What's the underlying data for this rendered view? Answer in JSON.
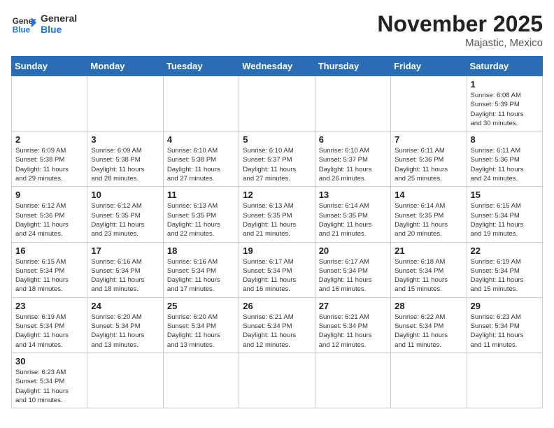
{
  "header": {
    "logo_general": "General",
    "logo_blue": "Blue",
    "month_title": "November 2025",
    "location": "Majastic, Mexico"
  },
  "weekdays": [
    "Sunday",
    "Monday",
    "Tuesday",
    "Wednesday",
    "Thursday",
    "Friday",
    "Saturday"
  ],
  "weeks": [
    [
      {
        "day": "",
        "info": ""
      },
      {
        "day": "",
        "info": ""
      },
      {
        "day": "",
        "info": ""
      },
      {
        "day": "",
        "info": ""
      },
      {
        "day": "",
        "info": ""
      },
      {
        "day": "",
        "info": ""
      },
      {
        "day": "1",
        "info": "Sunrise: 6:08 AM\nSunset: 5:39 PM\nDaylight: 11 hours\nand 30 minutes."
      }
    ],
    [
      {
        "day": "2",
        "info": "Sunrise: 6:09 AM\nSunset: 5:38 PM\nDaylight: 11 hours\nand 29 minutes."
      },
      {
        "day": "3",
        "info": "Sunrise: 6:09 AM\nSunset: 5:38 PM\nDaylight: 11 hours\nand 28 minutes."
      },
      {
        "day": "4",
        "info": "Sunrise: 6:10 AM\nSunset: 5:38 PM\nDaylight: 11 hours\nand 27 minutes."
      },
      {
        "day": "5",
        "info": "Sunrise: 6:10 AM\nSunset: 5:37 PM\nDaylight: 11 hours\nand 27 minutes."
      },
      {
        "day": "6",
        "info": "Sunrise: 6:10 AM\nSunset: 5:37 PM\nDaylight: 11 hours\nand 26 minutes."
      },
      {
        "day": "7",
        "info": "Sunrise: 6:11 AM\nSunset: 5:36 PM\nDaylight: 11 hours\nand 25 minutes."
      },
      {
        "day": "8",
        "info": "Sunrise: 6:11 AM\nSunset: 5:36 PM\nDaylight: 11 hours\nand 24 minutes."
      }
    ],
    [
      {
        "day": "9",
        "info": "Sunrise: 6:12 AM\nSunset: 5:36 PM\nDaylight: 11 hours\nand 24 minutes."
      },
      {
        "day": "10",
        "info": "Sunrise: 6:12 AM\nSunset: 5:35 PM\nDaylight: 11 hours\nand 23 minutes."
      },
      {
        "day": "11",
        "info": "Sunrise: 6:13 AM\nSunset: 5:35 PM\nDaylight: 11 hours\nand 22 minutes."
      },
      {
        "day": "12",
        "info": "Sunrise: 6:13 AM\nSunset: 5:35 PM\nDaylight: 11 hours\nand 21 minutes."
      },
      {
        "day": "13",
        "info": "Sunrise: 6:14 AM\nSunset: 5:35 PM\nDaylight: 11 hours\nand 21 minutes."
      },
      {
        "day": "14",
        "info": "Sunrise: 6:14 AM\nSunset: 5:35 PM\nDaylight: 11 hours\nand 20 minutes."
      },
      {
        "day": "15",
        "info": "Sunrise: 6:15 AM\nSunset: 5:34 PM\nDaylight: 11 hours\nand 19 minutes."
      }
    ],
    [
      {
        "day": "16",
        "info": "Sunrise: 6:15 AM\nSunset: 5:34 PM\nDaylight: 11 hours\nand 18 minutes."
      },
      {
        "day": "17",
        "info": "Sunrise: 6:16 AM\nSunset: 5:34 PM\nDaylight: 11 hours\nand 18 minutes."
      },
      {
        "day": "18",
        "info": "Sunrise: 6:16 AM\nSunset: 5:34 PM\nDaylight: 11 hours\nand 17 minutes."
      },
      {
        "day": "19",
        "info": "Sunrise: 6:17 AM\nSunset: 5:34 PM\nDaylight: 11 hours\nand 16 minutes."
      },
      {
        "day": "20",
        "info": "Sunrise: 6:17 AM\nSunset: 5:34 PM\nDaylight: 11 hours\nand 16 minutes."
      },
      {
        "day": "21",
        "info": "Sunrise: 6:18 AM\nSunset: 5:34 PM\nDaylight: 11 hours\nand 15 minutes."
      },
      {
        "day": "22",
        "info": "Sunrise: 6:19 AM\nSunset: 5:34 PM\nDaylight: 11 hours\nand 15 minutes."
      }
    ],
    [
      {
        "day": "23",
        "info": "Sunrise: 6:19 AM\nSunset: 5:34 PM\nDaylight: 11 hours\nand 14 minutes."
      },
      {
        "day": "24",
        "info": "Sunrise: 6:20 AM\nSunset: 5:34 PM\nDaylight: 11 hours\nand 13 minutes."
      },
      {
        "day": "25",
        "info": "Sunrise: 6:20 AM\nSunset: 5:34 PM\nDaylight: 11 hours\nand 13 minutes."
      },
      {
        "day": "26",
        "info": "Sunrise: 6:21 AM\nSunset: 5:34 PM\nDaylight: 11 hours\nand 12 minutes."
      },
      {
        "day": "27",
        "info": "Sunrise: 6:21 AM\nSunset: 5:34 PM\nDaylight: 11 hours\nand 12 minutes."
      },
      {
        "day": "28",
        "info": "Sunrise: 6:22 AM\nSunset: 5:34 PM\nDaylight: 11 hours\nand 11 minutes."
      },
      {
        "day": "29",
        "info": "Sunrise: 6:23 AM\nSunset: 5:34 PM\nDaylight: 11 hours\nand 11 minutes."
      }
    ],
    [
      {
        "day": "30",
        "info": "Sunrise: 6:23 AM\nSunset: 5:34 PM\nDaylight: 11 hours\nand 10 minutes."
      },
      {
        "day": "",
        "info": ""
      },
      {
        "day": "",
        "info": ""
      },
      {
        "day": "",
        "info": ""
      },
      {
        "day": "",
        "info": ""
      },
      {
        "day": "",
        "info": ""
      },
      {
        "day": "",
        "info": ""
      }
    ]
  ]
}
